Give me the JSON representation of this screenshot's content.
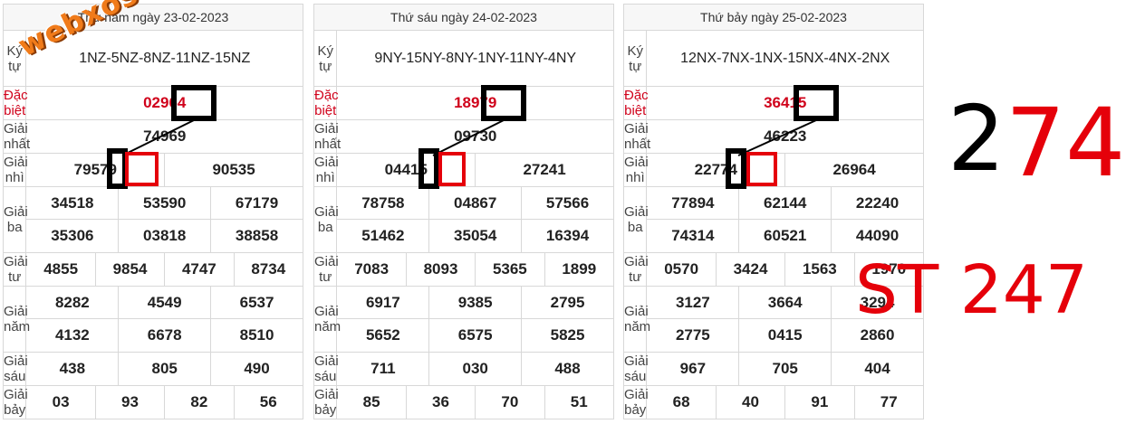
{
  "labels": {
    "kytu": "Ký tự",
    "db": "Đặc biệt",
    "g1": "Giải nhất",
    "g2": "Giải nhì",
    "g3": "Giải ba",
    "g4": "Giải tư",
    "g5": "Giải năm",
    "g6": "Giải sáu",
    "g7": "Giải bảy"
  },
  "watermark": "webxoso.net",
  "annotation": {
    "top_digit": "2",
    "top_red": "74",
    "bottom_text": "ST 247"
  },
  "tables": [
    {
      "header": "Thứ năm ngày 23-02-2023",
      "kytu": "1NZ-5NZ-8NZ-11NZ-15NZ",
      "db": "02964",
      "g1": "74969",
      "g2": [
        "79579",
        "90535"
      ],
      "g3": [
        "34518",
        "53590",
        "67179",
        "35306",
        "03818",
        "38858"
      ],
      "g4": [
        "4855",
        "9854",
        "4747",
        "8734"
      ],
      "g5": [
        "8282",
        "4549",
        "6537",
        "4132",
        "6678",
        "8510"
      ],
      "g6": [
        "438",
        "805",
        "490"
      ],
      "g7": [
        "03",
        "93",
        "82",
        "56"
      ]
    },
    {
      "header": "Thứ sáu ngày 24-02-2023",
      "kytu": "9NY-15NY-8NY-1NY-11NY-4NY",
      "db": "18979",
      "g1": "09730",
      "g2": [
        "04415",
        "27241"
      ],
      "g3": [
        "78758",
        "04867",
        "57566",
        "51462",
        "35054",
        "16394"
      ],
      "g4": [
        "7083",
        "8093",
        "5365",
        "1899"
      ],
      "g5": [
        "6917",
        "9385",
        "2795",
        "5652",
        "6575",
        "5825"
      ],
      "g6": [
        "711",
        "030",
        "488"
      ],
      "g7": [
        "85",
        "36",
        "70",
        "51"
      ]
    },
    {
      "header": "Thứ bảy ngày 25-02-2023",
      "kytu": "12NX-7NX-1NX-15NX-4NX-2NX",
      "db": "36415",
      "g1": "46223",
      "g2": [
        "22774",
        "26964"
      ],
      "g3": [
        "77894",
        "62144",
        "22240",
        "74314",
        "60521",
        "44090"
      ],
      "g4": [
        "0570",
        "3424",
        "1563",
        "1970"
      ],
      "g5": [
        "3127",
        "3664",
        "3294",
        "2775",
        "0415",
        "2860"
      ],
      "g6": [
        "967",
        "705",
        "404"
      ],
      "g7": [
        "68",
        "40",
        "91",
        "77"
      ]
    }
  ]
}
